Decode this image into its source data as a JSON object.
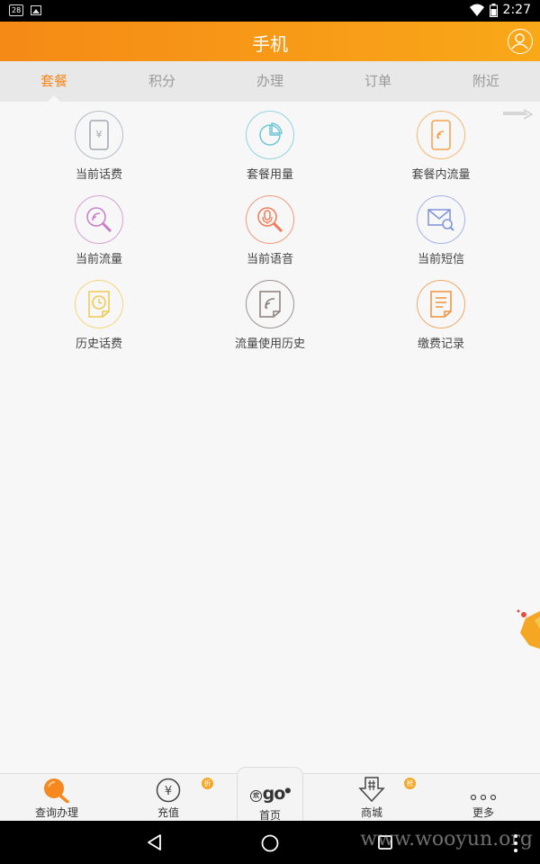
{
  "status_bar": {
    "notification_badge": "28",
    "time": "2:27"
  },
  "header": {
    "title": "手机"
  },
  "tabs": [
    {
      "label": "套餐",
      "active": true
    },
    {
      "label": "积分",
      "active": false
    },
    {
      "label": "办理",
      "active": false
    },
    {
      "label": "订单",
      "active": false
    },
    {
      "label": "附近",
      "active": false
    }
  ],
  "grid_items": [
    {
      "label": "当前话费",
      "icon": "phone-bill-icon",
      "color": "#9aa6b2"
    },
    {
      "label": "套餐用量",
      "icon": "pie-chart-icon",
      "color": "#6ec6d8"
    },
    {
      "label": "套餐内流量",
      "icon": "data-phone-icon",
      "color": "#f5a04a"
    },
    {
      "label": "当前流量",
      "icon": "data-search-icon",
      "color": "#c77fc7"
    },
    {
      "label": "当前语音",
      "icon": "mic-search-icon",
      "color": "#ee7b55"
    },
    {
      "label": "当前短信",
      "icon": "sms-search-icon",
      "color": "#7f93d8"
    },
    {
      "label": "历史话费",
      "icon": "clock-doc-icon",
      "color": "#f0c850"
    },
    {
      "label": "流量使用历史",
      "icon": "data-doc-icon",
      "color": "#8a7f7a"
    },
    {
      "label": "缴费记录",
      "icon": "record-doc-icon",
      "color": "#f0903a"
    }
  ],
  "bottom_nav": {
    "items": [
      {
        "label": "查询办理",
        "active": true
      },
      {
        "label": "充值",
        "badge": "折"
      },
      {
        "label": "首页",
        "logo": "go"
      },
      {
        "label": "商城",
        "badge": "抢"
      },
      {
        "label": "更多"
      }
    ]
  },
  "watermark": "www.wooyun.org",
  "colors": {
    "accent": "#f5881f",
    "header_start": "#f58a16",
    "header_end": "#f9a818"
  }
}
